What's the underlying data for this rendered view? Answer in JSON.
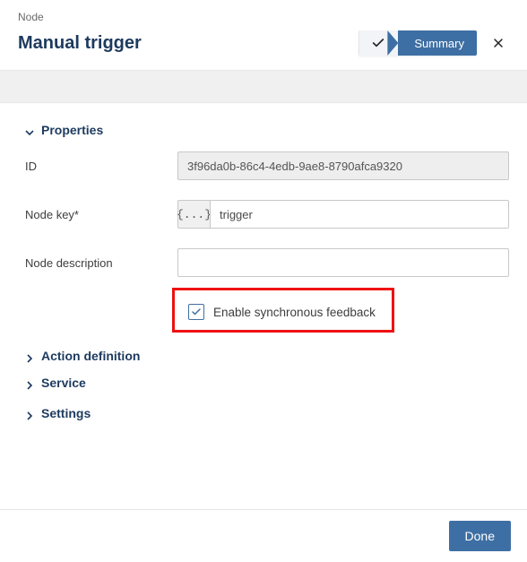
{
  "breadcrumb": "Node",
  "title": "Manual trigger",
  "summary": {
    "label": "Summary"
  },
  "sections": {
    "properties": "Properties",
    "action_definition": "Action definition",
    "service": "Service",
    "settings": "Settings"
  },
  "form": {
    "id_label": "ID",
    "id_value": "3f96da0b-86c4-4edb-9ae8-8790afca9320",
    "node_key_label": "Node key*",
    "node_key_addon": "{...}",
    "node_key_value": "trigger",
    "node_desc_label": "Node description",
    "node_desc_value": "",
    "sync_feedback_label": "Enable synchronous feedback",
    "sync_feedback_checked": true
  },
  "footer": {
    "done": "Done"
  }
}
